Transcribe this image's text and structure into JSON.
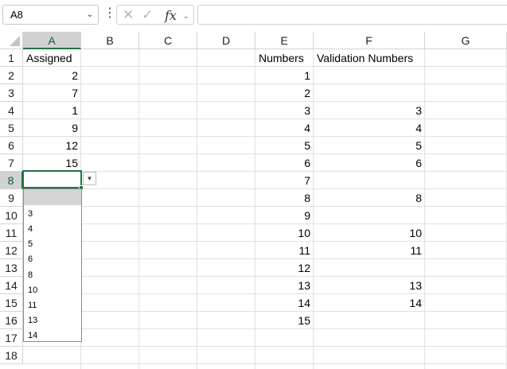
{
  "formula_bar": {
    "name_box": "A8",
    "name_box_menu": "⌄",
    "more": "⋮",
    "cancel": "✕",
    "enter": "✓",
    "fx": "fx",
    "fx_menu": "⌄",
    "formula": ""
  },
  "columns": [
    "A",
    "B",
    "C",
    "D",
    "E",
    "F",
    "G"
  ],
  "rows": [
    "1",
    "2",
    "3",
    "4",
    "5",
    "6",
    "7",
    "8",
    "9",
    "10",
    "11",
    "12",
    "13",
    "14",
    "15",
    "16",
    "17",
    "18"
  ],
  "cells": {
    "A1": "Assigned",
    "A2": "2",
    "A3": "7",
    "A4": "1",
    "A5": "9",
    "A6": "12",
    "A7": "15",
    "E1": "Numbers",
    "E2": "1",
    "E3": "2",
    "E4": "3",
    "E5": "4",
    "E6": "5",
    "E7": "6",
    "E8": "7",
    "E9": "8",
    "E10": "9",
    "E11": "10",
    "E12": "11",
    "E13": "12",
    "E14": "13",
    "E15": "14",
    "E16": "15",
    "F1": "Validation Numbers",
    "F4": "3",
    "F5": "4",
    "F6": "5",
    "F7": "6",
    "F9": "8",
    "F11": "10",
    "F12": "11",
    "F14": "13",
    "F15": "14"
  },
  "dropdown": {
    "button": "▼",
    "options": [
      "",
      "3",
      "4",
      "5",
      "6",
      "8",
      "10",
      "11",
      "13",
      "14"
    ]
  },
  "colors": {
    "accent": "#217346",
    "selected_header": "#d2d2d2",
    "highlight": "#d4d4d4"
  }
}
